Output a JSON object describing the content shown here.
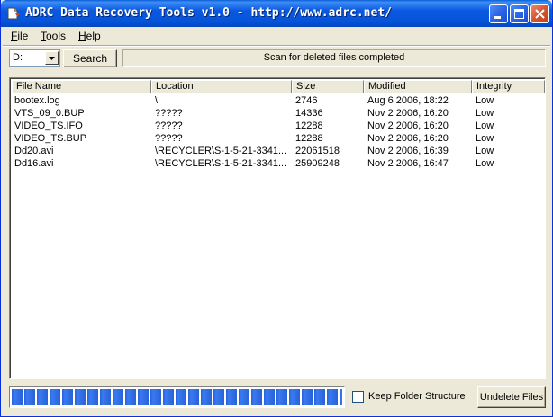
{
  "window": {
    "title": "ADRC Data Recovery Tools v1.0 - http://www.adrc.net/",
    "icon": "app-icon",
    "controls": [
      "minimize-icon",
      "maximize-icon",
      "close-icon"
    ]
  },
  "menu": {
    "file": "File",
    "tools": "Tools",
    "help": "Help"
  },
  "toolbar": {
    "drive_value": "D:",
    "search_label": "Search",
    "status_text": "Scan for deleted files completed"
  },
  "table": {
    "columns": [
      "File Name",
      "Location",
      "Size",
      "Modified",
      "Integrity"
    ],
    "rows": [
      [
        "bootex.log",
        "\\",
        "2746",
        "Aug 6 2006, 18:22",
        "Low"
      ],
      [
        "VTS_09_0.BUP",
        "?????",
        "14336",
        "Nov 2 2006, 16:20",
        "Low"
      ],
      [
        "VIDEO_TS.IFO",
        "?????",
        "12288",
        "Nov 2 2006, 16:20",
        "Low"
      ],
      [
        "VIDEO_TS.BUP",
        "?????",
        "12288",
        "Nov 2 2006, 16:20",
        "Low"
      ],
      [
        "Dd20.avi",
        "\\RECYCLER\\S-1-5-21-3341...",
        "22061518",
        "Nov 2 2006, 16:39",
        "Low"
      ],
      [
        "Dd16.avi",
        "\\RECYCLER\\S-1-5-21-3341...",
        "25909248",
        "Nov 2 2006, 16:47",
        "Low"
      ]
    ]
  },
  "footer": {
    "progress_fraction": 1.0,
    "keep_folder_label": "Keep Folder Structure",
    "keep_folder_checked": false,
    "undelete_label": "Undelete Files"
  },
  "colors": {
    "titlebar_blue": "#0654d8",
    "progress_blue": "#2862d8",
    "window_face": "#ece9d8"
  }
}
